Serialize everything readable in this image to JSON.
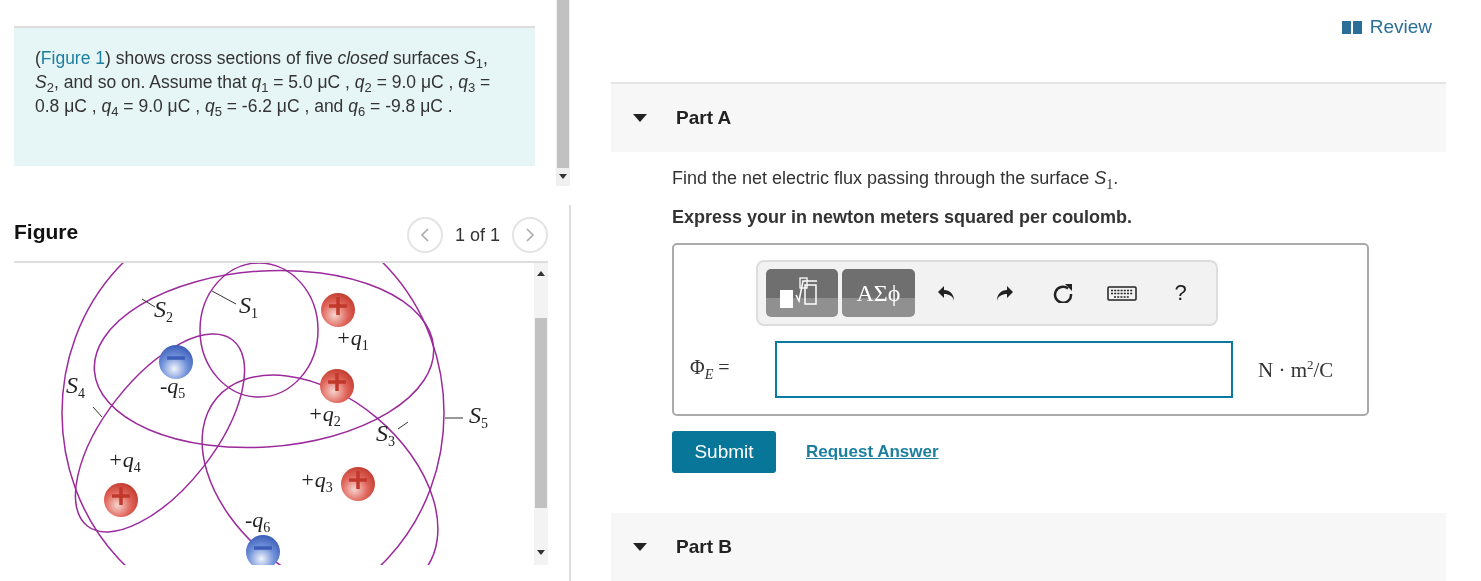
{
  "problem": {
    "open": "(",
    "link": "Figure 1",
    "text": ") shows cross sections of five *closed* surfaces *S*$_{1}$, *S*$_{2}$, and so on. Assume that *q*$_{1}$ = 5.0 μC , *q*$_{2}$ = 9.0 μC , *q*$_{3}$ = 0.8 μC , *q*$_{4}$ = 9.0 μC , *q*$_{5}$ = -6.2 μC , and *q*$_{6}$ = -9.8 μC ."
  },
  "figure": {
    "heading": "Figure",
    "pager": "1 of 1",
    "labels": [
      {
        "kind": "surface",
        "text": "S$_{2}$"
      },
      {
        "kind": "surface",
        "text": "S$_{1}$"
      },
      {
        "kind": "charge",
        "text": "+q$_{1}$"
      },
      {
        "kind": "charge",
        "text": "-q$_{5}$"
      },
      {
        "kind": "surface",
        "text": "S$_{4}$"
      },
      {
        "kind": "charge",
        "text": "+q$_{2}$"
      },
      {
        "kind": "surface",
        "text": "S$_{3}$"
      },
      {
        "kind": "surface",
        "text": "S$_{5}$"
      },
      {
        "kind": "charge",
        "text": "+q$_{4}$"
      },
      {
        "kind": "charge",
        "text": "+q$_{3}$"
      },
      {
        "kind": "charge",
        "text": "-q$_{6}$"
      }
    ],
    "charges": [
      {
        "kind": "positive"
      },
      {
        "kind": "positive"
      },
      {
        "kind": "negative"
      },
      {
        "kind": "positive"
      },
      {
        "kind": "positive"
      },
      {
        "kind": "negative"
      }
    ]
  },
  "review": "Review",
  "parts": [
    {
      "title": "Part A",
      "expanded": true,
      "question": "Find the net electric flux passing through the surface *S*$_{1}$.",
      "instruction": "Express your in newton meters squared per coulomb.",
      "toolbar": {
        "symbols": "ΑΣϕ",
        "help": "?"
      },
      "answer": {
        "label": "Φ$_{E}$ =",
        "units": "N · m$^{2}$/C"
      },
      "submit": "Submit",
      "request": "Request Answer"
    },
    {
      "title": "Part B",
      "expanded": true
    }
  ]
}
